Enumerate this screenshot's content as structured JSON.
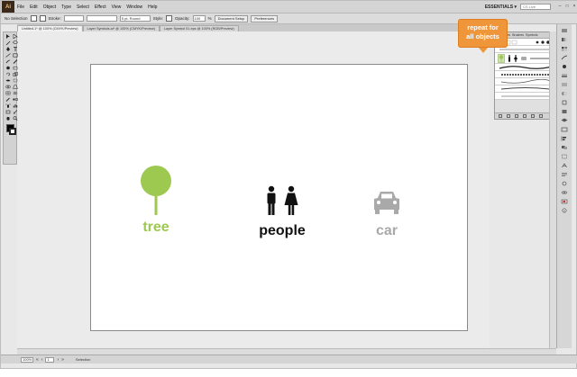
{
  "menubar": {
    "app_logo": "Ai",
    "items": [
      "File",
      "Edit",
      "Object",
      "Type",
      "Select",
      "Effect",
      "View",
      "Window",
      "Help"
    ],
    "essentials": "ESSENTIALS ▾",
    "search_placeholder": "CS Live",
    "window_buttons": [
      "–",
      "□",
      "×"
    ]
  },
  "controlbar": {
    "selection_label": "No Selection",
    "stroke_label": "Stroke:",
    "style_label": "Style:",
    "opacity_label": "Opacity:",
    "opacity_value": "100",
    "percent": "%",
    "brush_value": "5 pt. Round",
    "document_setup": "Document Setup",
    "preferences": "Preferences"
  },
  "tabs": [
    {
      "label": "Untitled-1* @ 100% (CMYK/Preview)",
      "active": true
    },
    {
      "label": "Layer Symbols.ai* @ 100% (CMYK/Preview)",
      "active": false
    },
    {
      "label": "Layer Symbol 01.eps @ 100% (RGB/Preview)",
      "active": false
    }
  ],
  "artboard": {
    "groups": [
      {
        "label": "tree",
        "color": "#9dc950",
        "icon": "tree-icon"
      },
      {
        "label": "people",
        "color": "#111111",
        "icon": "people-icon"
      },
      {
        "label": "car",
        "color": "#a9a9a9",
        "icon": "car-icon"
      }
    ]
  },
  "callout": {
    "line1": "repeat for",
    "line2": "all objects",
    "color": "#f0963a"
  },
  "symbols_panel": {
    "tabs": [
      "Swatches",
      "Brushes",
      "Symbols"
    ]
  },
  "statusbar": {
    "zoom": "100%",
    "page": "1",
    "status": "Selection"
  }
}
